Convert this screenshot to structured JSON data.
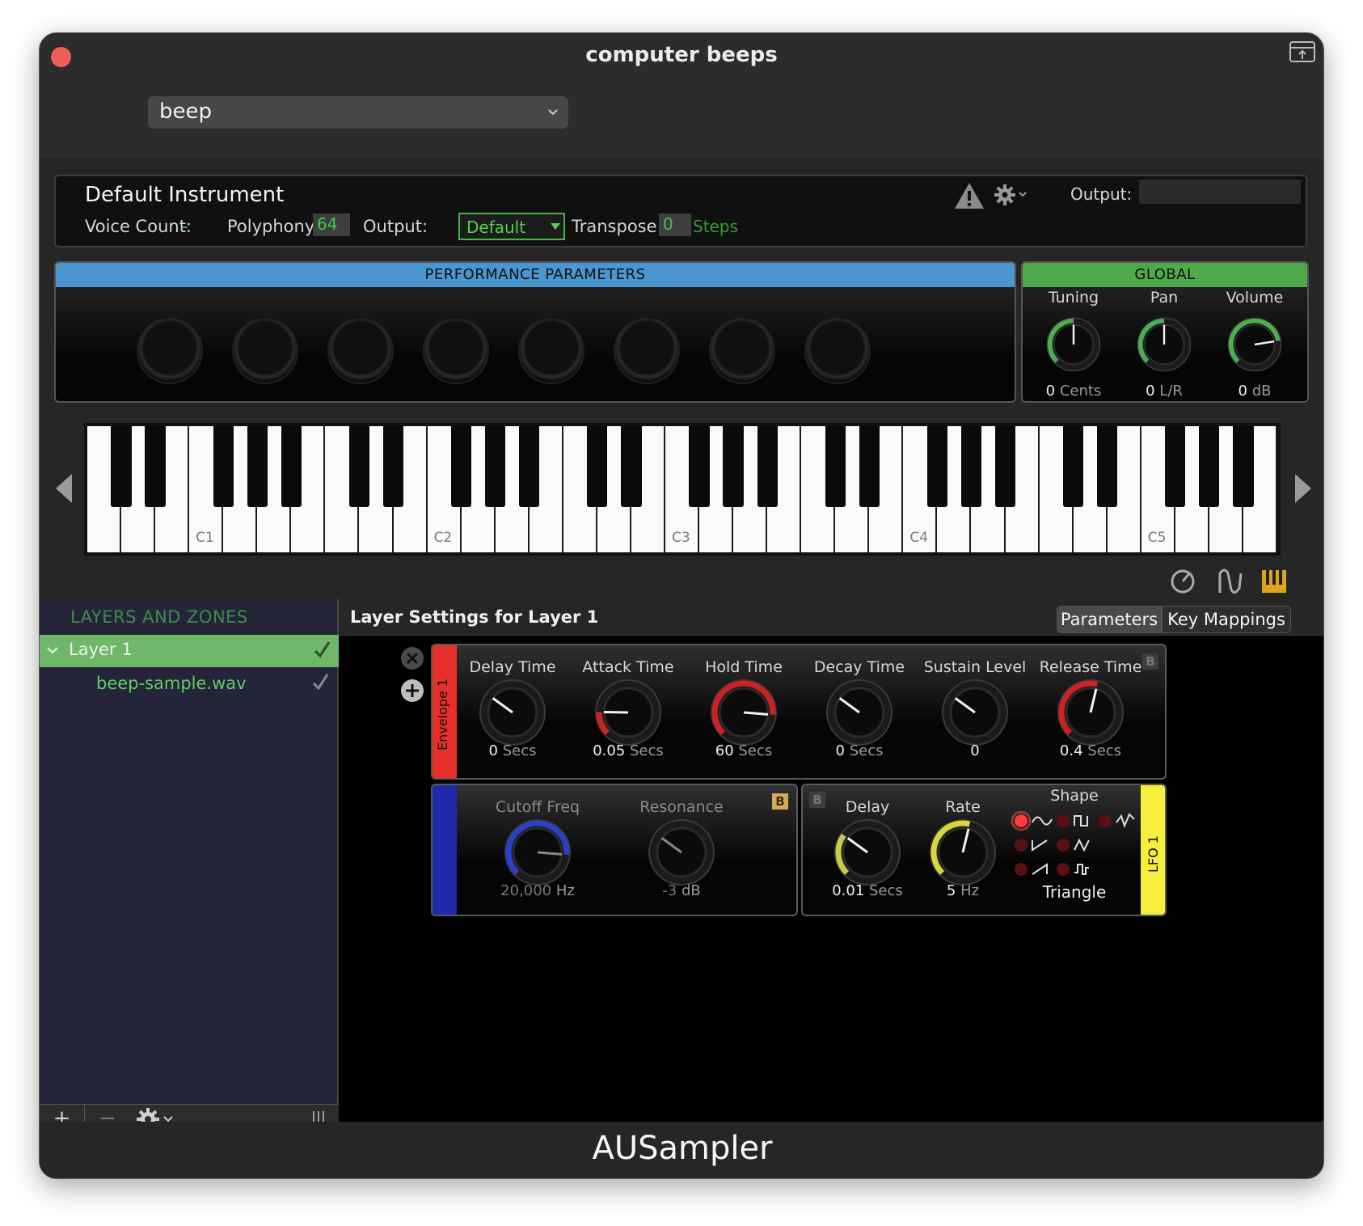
{
  "window": {
    "title": "computer beeps"
  },
  "preset": {
    "value": "beep"
  },
  "instrument": {
    "name": "Default Instrument",
    "voice_count_label": "Voice Count:",
    "voice_count_value": "-",
    "polyphony_label": "Polyphony:",
    "polyphony_value": "64",
    "output_label": "Output:",
    "output_value": "Default",
    "transpose_label": "Transpose:",
    "transpose_value": "0",
    "transpose_unit": "Steps",
    "output_meter_label": "Output:"
  },
  "performance": {
    "title": "PERFORMANCE PARAMETERS",
    "knob_count": 8
  },
  "global": {
    "title": "GLOBAL",
    "knobs": [
      {
        "label": "Tuning",
        "value": "0",
        "unit": "Cents",
        "level": 0.5,
        "color": "#4caf50"
      },
      {
        "label": "Pan",
        "value": "0",
        "unit": "L/R",
        "level": 0.5,
        "color": "#4caf50"
      },
      {
        "label": "Volume",
        "value": "0",
        "unit": "dB",
        "level": 0.8,
        "color": "#4caf50"
      }
    ]
  },
  "keyboard": {
    "octave_labels": [
      "C1",
      "C2",
      "C3",
      "C4",
      "C5"
    ]
  },
  "sidebar": {
    "header": "LAYERS AND ZONES",
    "layer": "Layer 1",
    "zone": "beep-sample.wav"
  },
  "layer_settings": {
    "title": "Layer Settings for Layer 1",
    "tabs": [
      "Parameters",
      "Key Mappings"
    ],
    "active_tab": 0
  },
  "envelope": {
    "label": "Envelope 1",
    "color": "#e8302a",
    "knobs": [
      {
        "label": "Delay Time",
        "value": "0",
        "unit": "Secs",
        "level": 0.3,
        "ring": "none"
      },
      {
        "label": "Attack Time",
        "value": "0.05",
        "unit": "Secs",
        "level": 0.17,
        "ring": "#cc2222"
      },
      {
        "label": "Hold Time",
        "value": "60",
        "unit": "Secs",
        "level": 0.85,
        "ring": "#cc2222"
      },
      {
        "label": "Decay Time",
        "value": "0",
        "unit": "Secs",
        "level": 0.3,
        "ring": "none"
      },
      {
        "label": "Sustain Level",
        "value": "0",
        "unit": "",
        "level": 0.3,
        "ring": "none"
      },
      {
        "label": "Release Time",
        "value": "0.4",
        "unit": "Secs",
        "level": 0.55,
        "ring": "#cc2222"
      }
    ],
    "badge": "B"
  },
  "filter": {
    "color": "#1f2aa8",
    "knobs": [
      {
        "label": "Cutoff Freq",
        "value": "20,000",
        "unit": "Hz",
        "level": 0.85,
        "ring": "#2b3fc9"
      },
      {
        "label": "Resonance",
        "value": "-3",
        "unit": "dB",
        "level": 0.3,
        "ring": "none"
      }
    ],
    "badge": "B"
  },
  "lfo": {
    "label": "LFO 1",
    "color": "#f5ee3a",
    "badge": "B",
    "knobs": [
      {
        "label": "Delay",
        "value": "0.01",
        "unit": "Secs",
        "level": 0.3,
        "ring": "#c8c84a"
      },
      {
        "label": "Rate",
        "value": "5",
        "unit": "Hz",
        "level": 0.55,
        "ring": "#d8d83a"
      }
    ],
    "shape_label": "Shape",
    "shape_value": "Triangle"
  },
  "footer": {
    "text": "AUSampler"
  }
}
